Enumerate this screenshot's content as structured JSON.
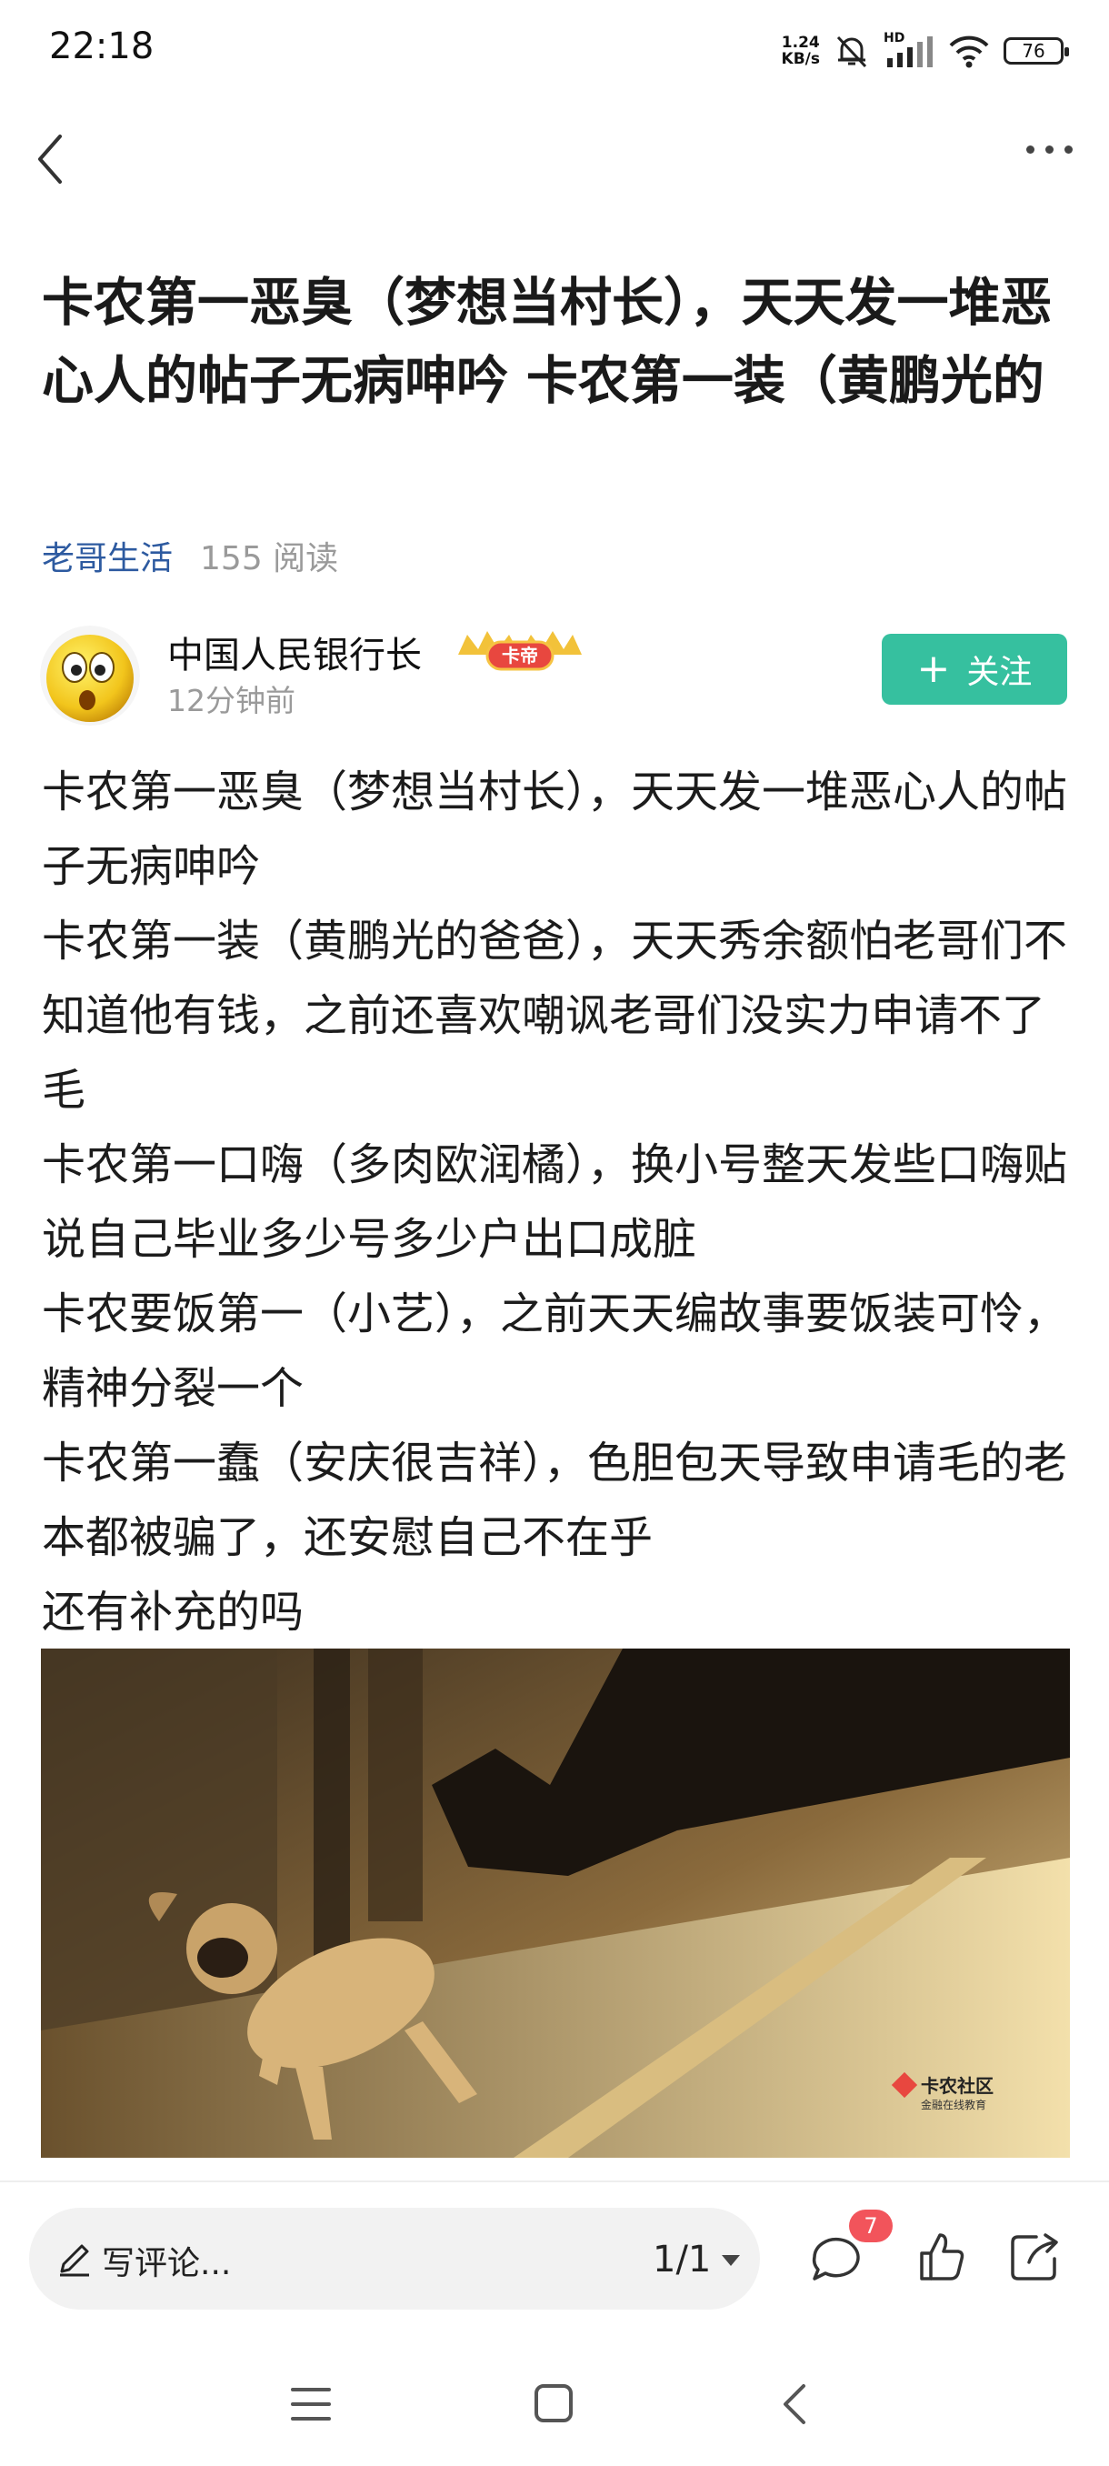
{
  "status_bar": {
    "time": "22:18",
    "net_speed_value": "1.24",
    "net_speed_unit": "KB/s",
    "network_type": "HD",
    "battery": "76",
    "icons": [
      "mute-bell-icon",
      "signal-icon",
      "wifi-icon",
      "battery-icon"
    ]
  },
  "nav": {
    "back_icon": "chevron-left-icon",
    "more_icon": "more-dots-icon"
  },
  "post": {
    "title": "卡农第一恶臭（梦想当村长），天天发一堆恶心人的帖子无病呻吟 卡农第一装（黄鹏光的",
    "category": "老哥生活",
    "reads": "155 阅读",
    "author": {
      "name": "中国人民银行长",
      "badge": "卡帝",
      "time": "12分钟前"
    },
    "follow_label": "关注",
    "body_lines": [
      "卡农第一恶臭（梦想当村长），天天发一堆恶心人的帖子无病呻吟",
      "卡农第一装（黄鹏光的爸爸），天天秀余额怕老哥们不知道他有钱，之前还喜欢嘲讽老哥们没实力申请不了毛",
      "卡农第一口嗨（多肉欧润橘），换小号整天发些口嗨贴说自己毕业多少号多少户出口成脏",
      "卡农要饭第一（小艺），之前天天编故事要饭装可怜，精神分裂一个",
      "卡农第一蠢（安庆很吉祥），色胆包天导致申请毛的老本都被骗了，还安慰自己不在乎",
      "还有补充的吗"
    ],
    "image_watermark": "卡农社区",
    "image_watermark_sub": "金融在线教育"
  },
  "bottom_bar": {
    "comment_placeholder": "写评论...",
    "page_indicator": "1/1",
    "comment_count": "7"
  },
  "colors": {
    "accent": "#36c09f",
    "category": "#2d5aa0",
    "badge_red": "#f2545b"
  }
}
